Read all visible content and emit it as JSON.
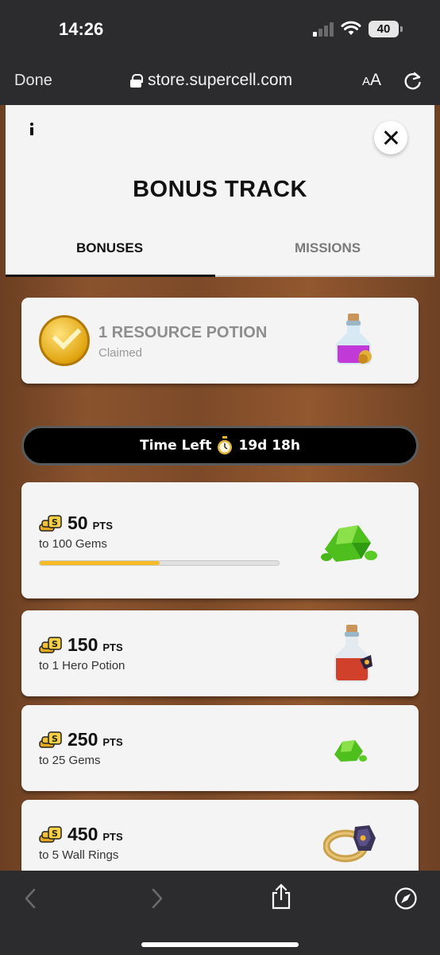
{
  "status_bar": {
    "time": "14:26",
    "battery": "40"
  },
  "browser": {
    "done_label": "Done",
    "url": "store.supercell.com",
    "aa_large": "A",
    "aa_small": "A"
  },
  "modal": {
    "title": "BONUS TRACK",
    "tabs": [
      {
        "label": "BONUSES",
        "active": true
      },
      {
        "label": "MISSIONS",
        "active": false
      }
    ]
  },
  "claimed": {
    "title": "1 RESOURCE POTION",
    "status": "Claimed"
  },
  "timer": {
    "label": "Time Left",
    "value": "19d 18h"
  },
  "track": [
    {
      "points": "50",
      "unit": "PTS",
      "reward": "to 100 Gems",
      "progress": 0.5,
      "icon": "gems-pile-icon"
    },
    {
      "points": "150",
      "unit": "PTS",
      "reward": "to 1 Hero Potion",
      "icon": "hero-potion-icon"
    },
    {
      "points": "250",
      "unit": "PTS",
      "reward": "to 25 Gems",
      "icon": "gems-small-icon"
    },
    {
      "points": "450",
      "unit": "PTS",
      "reward": "to 5 Wall Rings",
      "icon": "wall-ring-icon"
    }
  ],
  "colors": {
    "progress": "#f6bb25",
    "background": "#7c4a28"
  }
}
